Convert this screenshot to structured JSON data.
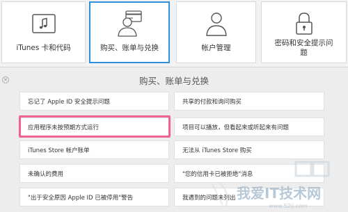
{
  "cards": [
    {
      "label": "iTunes 卡和代码",
      "icon": "music-note-icon"
    },
    {
      "label": "购买、账单与兑换",
      "icon": "person-card-icon"
    },
    {
      "label": "帐户管理",
      "icon": "person-icon"
    },
    {
      "label": "密码和安全提示问题",
      "icon": "lock-icon"
    }
  ],
  "panel": {
    "title": "购买、账单与兑换",
    "left_items": [
      "忘记了 Apple ID 安全提示问题",
      "应用程序未按预期方式运行",
      "iTunes Store 帐户账单",
      "未确认的费用",
      "\"出于安全原因 Apple ID 已被停用\"警告"
    ],
    "right_items": [
      "共享的付款和询问购买",
      "项目可以播放，但看起来或听起来有问题",
      "无法从 iTunes Store 购买",
      "\"您的信用卡已被拒绝\"消息",
      "我遇到的问题未列出"
    ]
  },
  "watermark": {
    "text": "我爱IT技术网",
    "url": "www.52ij.com"
  },
  "colors": {
    "selected_border": "#2f8fd8",
    "highlight": "#f06292"
  }
}
